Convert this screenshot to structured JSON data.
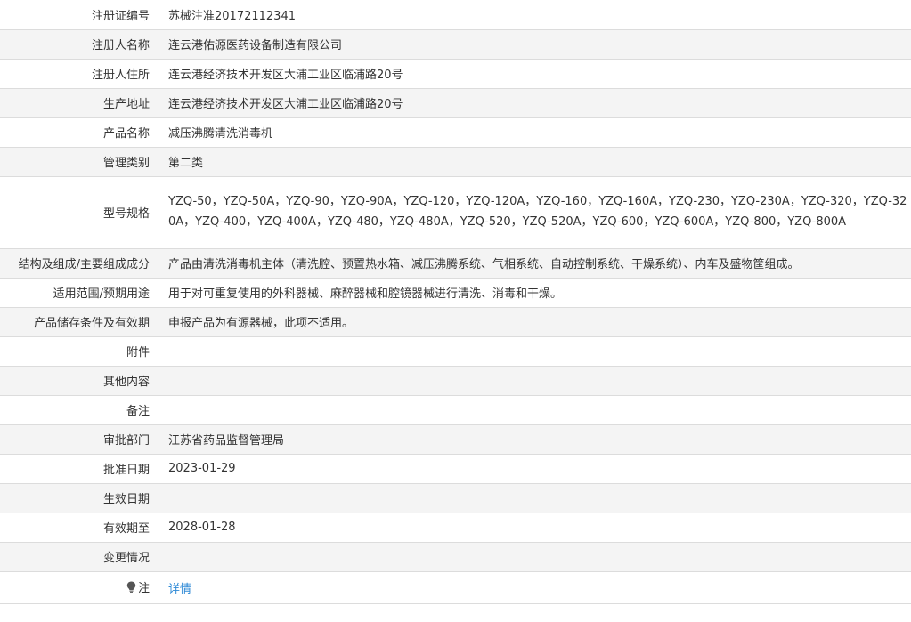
{
  "rows": [
    {
      "label": "注册证编号",
      "value": "苏械注准20172112341"
    },
    {
      "label": "注册人名称",
      "value": "连云港佑源医药设备制造有限公司"
    },
    {
      "label": "注册人住所",
      "value": "连云港经济技术开发区大浦工业区临浦路20号"
    },
    {
      "label": "生产地址",
      "value": "连云港经济技术开发区大浦工业区临浦路20号"
    },
    {
      "label": "产品名称",
      "value": "减压沸腾清洗消毒机"
    },
    {
      "label": "管理类别",
      "value": "第二类"
    },
    {
      "label": "型号规格",
      "value": "YZQ-50，YZQ-50A，YZQ-90，YZQ-90A，YZQ-120，YZQ-120A，YZQ-160，YZQ-160A，YZQ-230，YZQ-230A，YZQ-320，YZQ-320A，YZQ-400，YZQ-400A，YZQ-480，YZQ-480A，YZQ-520，YZQ-520A，YZQ-600，YZQ-600A，YZQ-800，YZQ-800A"
    },
    {
      "label": "结构及组成/主要组成成分",
      "value": "产品由清洗消毒机主体（清洗腔、预置热水箱、减压沸腾系统、气相系统、自动控制系统、干燥系统）、内车及盛物筐组成。"
    },
    {
      "label": "适用范围/预期用途",
      "value": "用于对可重复使用的外科器械、麻醉器械和腔镜器械进行清洗、消毒和干燥。"
    },
    {
      "label": "产品储存条件及有效期",
      "value": "申报产品为有源器械，此项不适用。"
    },
    {
      "label": "附件",
      "value": ""
    },
    {
      "label": "其他内容",
      "value": ""
    },
    {
      "label": "备注",
      "value": ""
    },
    {
      "label": "审批部门",
      "value": "江苏省药品监督管理局"
    },
    {
      "label": "批准日期",
      "value": "2023-01-29"
    },
    {
      "label": "生效日期",
      "value": ""
    },
    {
      "label": "有效期至",
      "value": "2028-01-28"
    },
    {
      "label": "变更情况",
      "value": ""
    }
  ],
  "note": {
    "label": "注",
    "icon": "lightbulb-icon",
    "link_text": "详情",
    "link_color": "#2f8ad6"
  },
  "colors": {
    "alt_row": "#f4f4f4",
    "border": "#dcdcdc",
    "text": "#333333"
  }
}
